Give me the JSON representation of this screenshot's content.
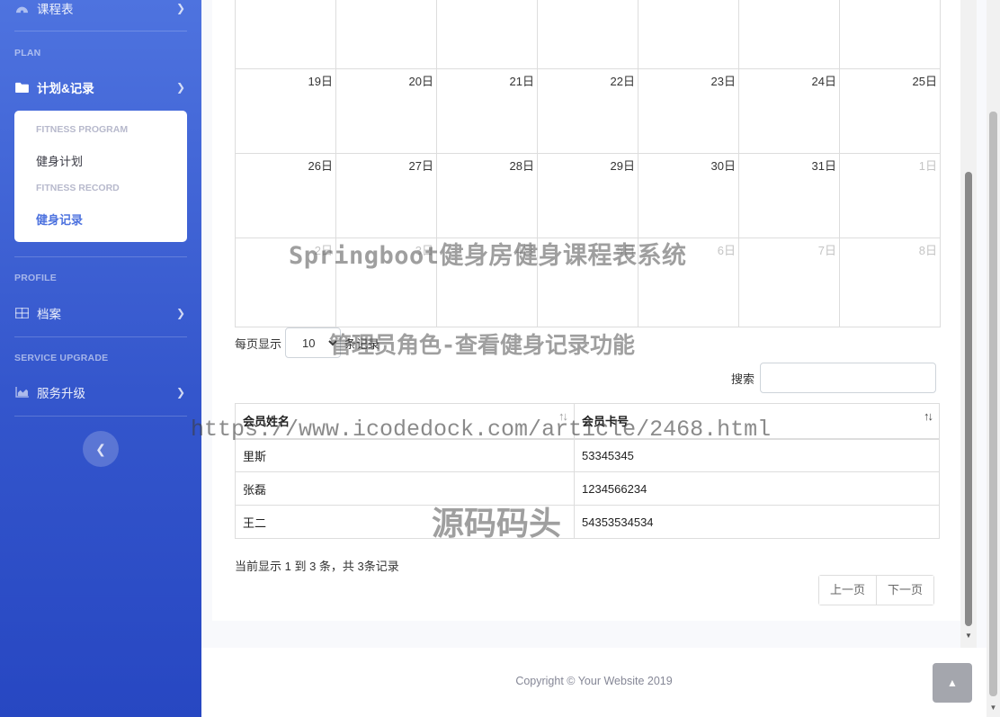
{
  "sidebar": {
    "top_item": {
      "label": "课程表"
    },
    "plan_heading": "PLAN",
    "plan_item": {
      "label": "计划&记录"
    },
    "collapse": {
      "fitness_program_heading": "FITNESS PROGRAM",
      "fitness_plan_label": "健身计划",
      "fitness_record_heading": "FITNESS RECORD",
      "fitness_record_label": "健身记录"
    },
    "profile_heading": "PROFILE",
    "profile_item": {
      "label": "档案"
    },
    "service_heading": "SERVICE UPGRADE",
    "service_item": {
      "label": "服务升级"
    },
    "icons": {
      "top": "dashboard-icon",
      "plan": "folder-icon",
      "profile": "table-icon",
      "service": "chart-area-icon",
      "toggle": "chevron-left-icon"
    }
  },
  "calendar": {
    "weeks": [
      [
        {
          "day": "",
          "other": false
        },
        {
          "day": "",
          "other": false
        },
        {
          "day": "",
          "other": false
        },
        {
          "day": "",
          "other": false
        },
        {
          "day": "",
          "other": false
        },
        {
          "day": "",
          "other": false
        },
        {
          "day": "",
          "other": false
        }
      ],
      [
        {
          "day": "19日",
          "other": false
        },
        {
          "day": "20日",
          "other": false
        },
        {
          "day": "21日",
          "other": false
        },
        {
          "day": "22日",
          "other": false
        },
        {
          "day": "23日",
          "other": false
        },
        {
          "day": "24日",
          "other": false
        },
        {
          "day": "25日",
          "other": false
        }
      ],
      [
        {
          "day": "26日",
          "other": false
        },
        {
          "day": "27日",
          "other": false
        },
        {
          "day": "28日",
          "other": false
        },
        {
          "day": "29日",
          "other": false
        },
        {
          "day": "30日",
          "other": false
        },
        {
          "day": "31日",
          "other": false
        },
        {
          "day": "1日",
          "other": true
        }
      ],
      [
        {
          "day": "2日",
          "other": true
        },
        {
          "day": "3日",
          "other": true
        },
        {
          "day": "4日",
          "other": true
        },
        {
          "day": "5日",
          "other": true
        },
        {
          "day": "6日",
          "other": true
        },
        {
          "day": "7日",
          "other": true
        },
        {
          "day": "8日",
          "other": true
        }
      ]
    ]
  },
  "table_controls": {
    "length_prefix": "每页显示",
    "length_value": "10",
    "length_suffix": "条记录",
    "search_label": "搜索",
    "search_value": ""
  },
  "table": {
    "headers": [
      "会员姓名",
      "会员卡号"
    ],
    "rows": [
      [
        "里斯",
        "53345345"
      ],
      [
        "张磊",
        "1234566234"
      ],
      [
        "王二",
        "54353534534"
      ]
    ],
    "sort_icon": "sort-icon"
  },
  "info_text": "当前显示 1 到 3 条，共 3条记录",
  "pagination": {
    "prev": "上一页",
    "next": "下一页"
  },
  "footer": "Copyright © Your Website 2019",
  "scroll_top_icon": "chevron-up-icon",
  "watermarks": [
    "Springboot健身房健身课程表系统",
    "管理员角色-查看健身记录功能",
    "https://www.icodedock.com/article/2468.html",
    "源码码头"
  ]
}
